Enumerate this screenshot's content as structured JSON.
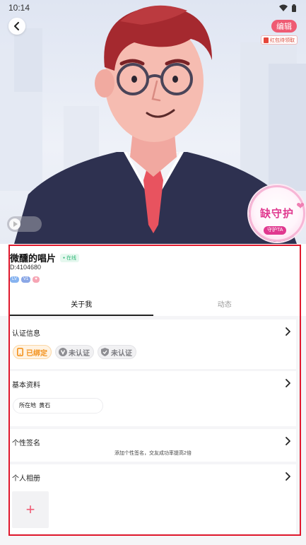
{
  "status_bar": {
    "time": "10:14"
  },
  "header": {
    "edit_label": "编辑",
    "redpacket_label": "红包待领取"
  },
  "guard": {
    "title": "缺守护",
    "button_label": "守护TA"
  },
  "profile": {
    "nickname": "微醺的唱片",
    "online_label": "在线",
    "id_text": "D:4104680",
    "tags": [
      "LV",
      "V1",
      "♥"
    ]
  },
  "tabs": [
    {
      "label": "关于我",
      "active": true
    },
    {
      "label": "动态",
      "active": false
    }
  ],
  "sections": {
    "auth": {
      "title": "认证信息",
      "badges": [
        {
          "label": "已绑定",
          "icon": "phone-icon"
        },
        {
          "label": "未认证",
          "icon": "v-verify-icon"
        },
        {
          "label": "未认证",
          "icon": "shield-check-icon"
        }
      ]
    },
    "basic": {
      "title": "基本资料",
      "location_label": "所在地",
      "location_value": "黄石"
    },
    "signature": {
      "title": "个性签名",
      "hint": "添加个性签名，交友成功率提高2倍"
    },
    "album": {
      "title": "个人相册",
      "add_symbol": "+"
    }
  },
  "colors": {
    "accent": "#ef5b73",
    "guard_pink": "#e0388f",
    "bound_orange": "#f3931f",
    "online_green": "#2bb673",
    "selection_red": "#e0182d"
  }
}
